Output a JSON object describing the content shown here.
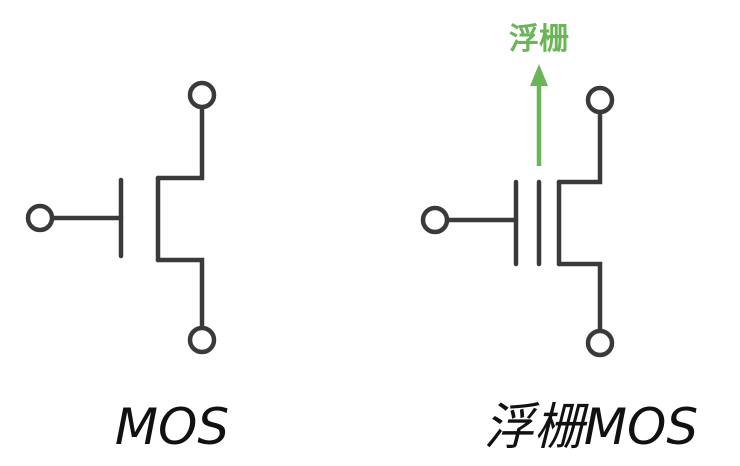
{
  "labels": {
    "mos_caption": "MOS",
    "fg_caption": "浮栅MOS",
    "floating_gate_label": "浮栅"
  },
  "colors": {
    "wire": "#3a3a3a",
    "arrow": "#6ab657",
    "caption_text": "#111111"
  }
}
